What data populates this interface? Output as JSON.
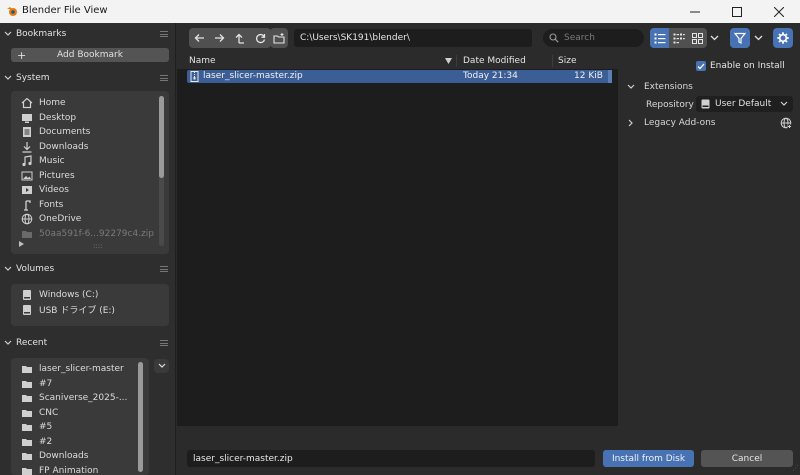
{
  "window": {
    "title": "Blender File View"
  },
  "sidebar": {
    "bookmarks": {
      "title": "Bookmarks",
      "add_label": "Add Bookmark"
    },
    "system": {
      "title": "System",
      "items": [
        {
          "label": "Home",
          "icon": "home-icon"
        },
        {
          "label": "Desktop",
          "icon": "desktop-icon"
        },
        {
          "label": "Documents",
          "icon": "documents-icon"
        },
        {
          "label": "Downloads",
          "icon": "downloads-icon"
        },
        {
          "label": "Music",
          "icon": "music-icon"
        },
        {
          "label": "Pictures",
          "icon": "pictures-icon"
        },
        {
          "label": "Videos",
          "icon": "videos-icon"
        },
        {
          "label": "Fonts",
          "icon": "fonts-icon"
        },
        {
          "label": "OneDrive",
          "icon": "globe-icon"
        },
        {
          "label": "50aa591f-6...92279c4.zip",
          "icon": "folder-icon"
        }
      ]
    },
    "volumes": {
      "title": "Volumes",
      "items": [
        {
          "label": "Windows (C:)",
          "icon": "drive-icon"
        },
        {
          "label": "USB ドライブ (E:)",
          "icon": "drive-icon"
        }
      ]
    },
    "recent": {
      "title": "Recent",
      "items": [
        {
          "label": "laser_slicer-master",
          "icon": "folder-icon"
        },
        {
          "label": "#7",
          "icon": "folder-icon"
        },
        {
          "label": "Scaniverse_2025-...",
          "icon": "folder-icon"
        },
        {
          "label": "CNC",
          "icon": "folder-icon"
        },
        {
          "label": "#5",
          "icon": "folder-icon"
        },
        {
          "label": "#2",
          "icon": "folder-icon"
        },
        {
          "label": "Downloads",
          "icon": "folder-icon"
        },
        {
          "label": "FP Animation",
          "icon": "folder-icon"
        }
      ]
    }
  },
  "toolbar": {
    "path": "C:\\Users\\SK191\\blender\\",
    "search_placeholder": "Search"
  },
  "file_list": {
    "columns": {
      "name": "Name",
      "date": "Date Modified",
      "size": "Size"
    },
    "rows": [
      {
        "name": "laser_slicer-master.zip",
        "date": "Today 21:34",
        "size": "12 KiB",
        "selected": true
      }
    ]
  },
  "options": {
    "enable_on_install": "Enable on Install",
    "extensions_title": "Extensions",
    "repository_label": "Repository",
    "repository_value": "User Default",
    "legacy_title": "Legacy Add-ons"
  },
  "footer": {
    "filename": "laser_slicer-master.zip",
    "install_label": "Install from Disk",
    "cancel_label": "Cancel"
  },
  "colors": {
    "accent": "#4772b3",
    "selection": "#3c5e96",
    "background": "#2b2b2b"
  }
}
